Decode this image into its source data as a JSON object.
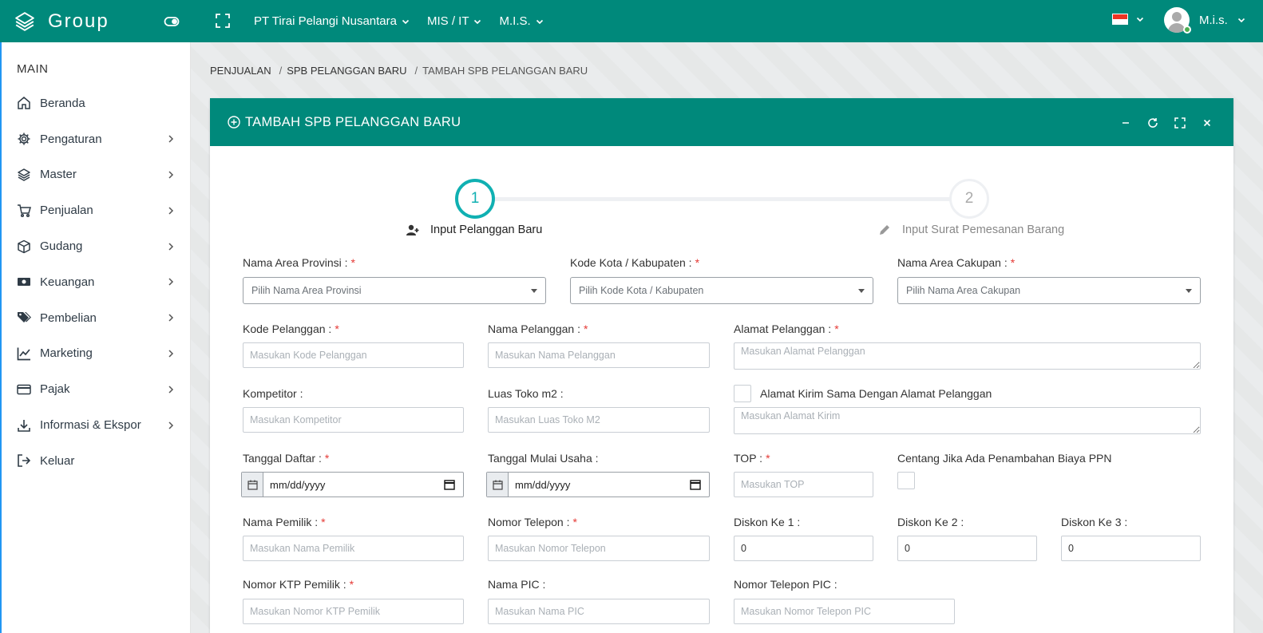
{
  "topbar": {
    "brand": "Group",
    "menu": [
      {
        "label": "PT Tirai Pelangi Nusantara"
      },
      {
        "label": "MIS / IT"
      },
      {
        "label": "M.I.S."
      }
    ],
    "user_name": "M.i.s."
  },
  "sidebar": {
    "section": "MAIN",
    "items": [
      {
        "label": "Beranda",
        "icon": "home-icon"
      },
      {
        "label": "Pengaturan",
        "icon": "gear-icon"
      },
      {
        "label": "Master",
        "icon": "layers-icon"
      },
      {
        "label": "Penjualan",
        "icon": "cart-icon"
      },
      {
        "label": "Gudang",
        "icon": "box-icon"
      },
      {
        "label": "Keuangan",
        "icon": "money-icon"
      },
      {
        "label": "Pembelian",
        "icon": "tags-icon"
      },
      {
        "label": "Marketing",
        "icon": "chart-line-icon"
      },
      {
        "label": "Pajak",
        "icon": "credit-card-icon"
      },
      {
        "label": "Informasi & Ekspor",
        "icon": "download-icon"
      },
      {
        "label": "Keluar",
        "icon": "logout-icon"
      }
    ]
  },
  "breadcrumb": {
    "items": [
      "PENJUALAN",
      "SPB PELANGGAN BARU",
      "TAMBAH SPB PELANGGAN BARU"
    ]
  },
  "card": {
    "title": "TAMBAH SPB PELANGGAN BARU"
  },
  "wizard": {
    "step1_number": "1",
    "step1_label": "Input Pelanggan Baru",
    "step2_number": "2",
    "step2_label": "Input Surat Pemesanan Barang"
  },
  "form": {
    "provinsi": {
      "label": "Nama Area Provinsi :",
      "placeholder": "Pilih Nama Area Provinsi"
    },
    "kota": {
      "label": "Kode Kota / Kabupaten :",
      "placeholder": "Pilih Kode Kota / Kabupaten"
    },
    "cakupan": {
      "label": "Nama Area Cakupan :",
      "placeholder": "Pilih Nama Area Cakupan"
    },
    "kode_pelanggan": {
      "label": "Kode Pelanggan :",
      "placeholder": "Masukan Kode Pelanggan"
    },
    "nama_pelanggan": {
      "label": "Nama Pelanggan :",
      "placeholder": "Masukan Nama Pelanggan"
    },
    "alamat_pelanggan": {
      "label": "Alamat Pelanggan :",
      "placeholder": "Masukan Alamat Pelanggan"
    },
    "kompetitor": {
      "label": "Kompetitor :",
      "placeholder": "Masukan Kompetitor"
    },
    "luas_toko": {
      "label": "Luas Toko m2 :",
      "placeholder": "Masukan Luas Toko M2"
    },
    "alamat_kirim": {
      "check_label": "Alamat Kirim Sama Dengan Alamat Pelanggan",
      "placeholder": "Masukan Alamat Kirim"
    },
    "tanggal_daftar": {
      "label": "Tanggal Daftar :",
      "value": "mm/dd/yyyy"
    },
    "tanggal_mulai": {
      "label": "Tanggal Mulai Usaha :",
      "value": "mm/dd/yyyy"
    },
    "top": {
      "label": "TOP :",
      "placeholder": "Masukan TOP"
    },
    "ppn": {
      "label": "Centang Jika Ada Penambahan Biaya PPN"
    },
    "nama_pemilik": {
      "label": "Nama Pemilik :",
      "placeholder": "Masukan Nama Pemilik"
    },
    "nomor_telepon": {
      "label": "Nomor Telepon :",
      "placeholder": "Masukan Nomor Telepon"
    },
    "diskon1": {
      "label": "Diskon Ke 1 :",
      "value": "0"
    },
    "diskon2": {
      "label": "Diskon Ke 2 :",
      "value": "0"
    },
    "diskon3": {
      "label": "Diskon Ke 3 :",
      "value": "0"
    },
    "ktp_pemilik": {
      "label": "Nomor KTP Pemilik :",
      "placeholder": "Masukan Nomor KTP Pemilik"
    },
    "nama_pic": {
      "label": "Nama PIC :",
      "placeholder": "Masukan Nama PIC"
    },
    "telepon_pic": {
      "label": "Nomor Telepon PIC :",
      "placeholder": "Masukan Nomor Telepon PIC"
    },
    "required_mark": "*"
  },
  "colors": {
    "primary": "#00897b",
    "step_active": "#10b0b2",
    "required": "#e53935"
  }
}
